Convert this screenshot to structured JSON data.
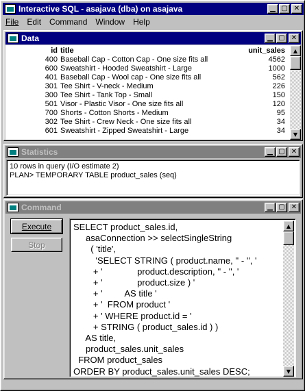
{
  "app": {
    "title": "Interactive SQL - asajava (dba) on asajava"
  },
  "menu": [
    "File",
    "Edit",
    "Command",
    "Window",
    "Help"
  ],
  "data_window": {
    "title": "Data",
    "columns": [
      "id",
      "title",
      "unit_sales"
    ],
    "rows": [
      [
        "400",
        "Baseball Cap - Cotton Cap - One size fits all",
        "4562"
      ],
      [
        "600",
        "Sweatshirt - Hooded Sweatshirt - Large",
        "1000"
      ],
      [
        "401",
        "Baseball Cap - Wool cap - One size fits all",
        "562"
      ],
      [
        "301",
        "Tee Shirt - V-neck - Medium",
        "226"
      ],
      [
        "300",
        "Tee Shirt - Tank Top - Small",
        "150"
      ],
      [
        "501",
        "Visor - Plastic Visor - One size fits all",
        "120"
      ],
      [
        "700",
        "Shorts - Cotton Shorts - Medium",
        "95"
      ],
      [
        "302",
        "Tee Shirt - Crew Neck - One size fits all",
        "34"
      ],
      [
        "601",
        "Sweatshirt - Zipped Sweatshirt - Large",
        "34"
      ]
    ]
  },
  "statistics_window": {
    "title": "Statistics",
    "lines": [
      "10 rows in query (I/O estimate 2)",
      "PLAN> TEMPORARY TABLE product_sales (seq)"
    ]
  },
  "command_window": {
    "title": "Command",
    "execute_label": "Execute",
    "stop_label": "Stop",
    "sql_lines": [
      "SELECT product_sales.id,",
      "     asaConnection >> selectSingleString",
      "       ( 'title',",
      "         'SELECT STRING ( product.name, '' - '', '",
      "        + '              product.description, '' - '', '",
      "        + '              product.size ) '",
      "        + '         AS title '",
      "        + '  FROM product '",
      "        + ' WHERE product.id = '",
      "        + STRING ( product_sales.id ) )",
      "     AS title,",
      "     product_sales.unit_sales",
      "  FROM product_sales",
      "ORDER BY product_sales.unit_sales DESC;"
    ]
  },
  "colors": {
    "active_title": "#000080",
    "inactive_title": "#808080",
    "face": "#c0c0c0"
  },
  "icons": {
    "minimize": "minimize-icon",
    "maximize": "maximize-icon",
    "close": "close-icon"
  }
}
